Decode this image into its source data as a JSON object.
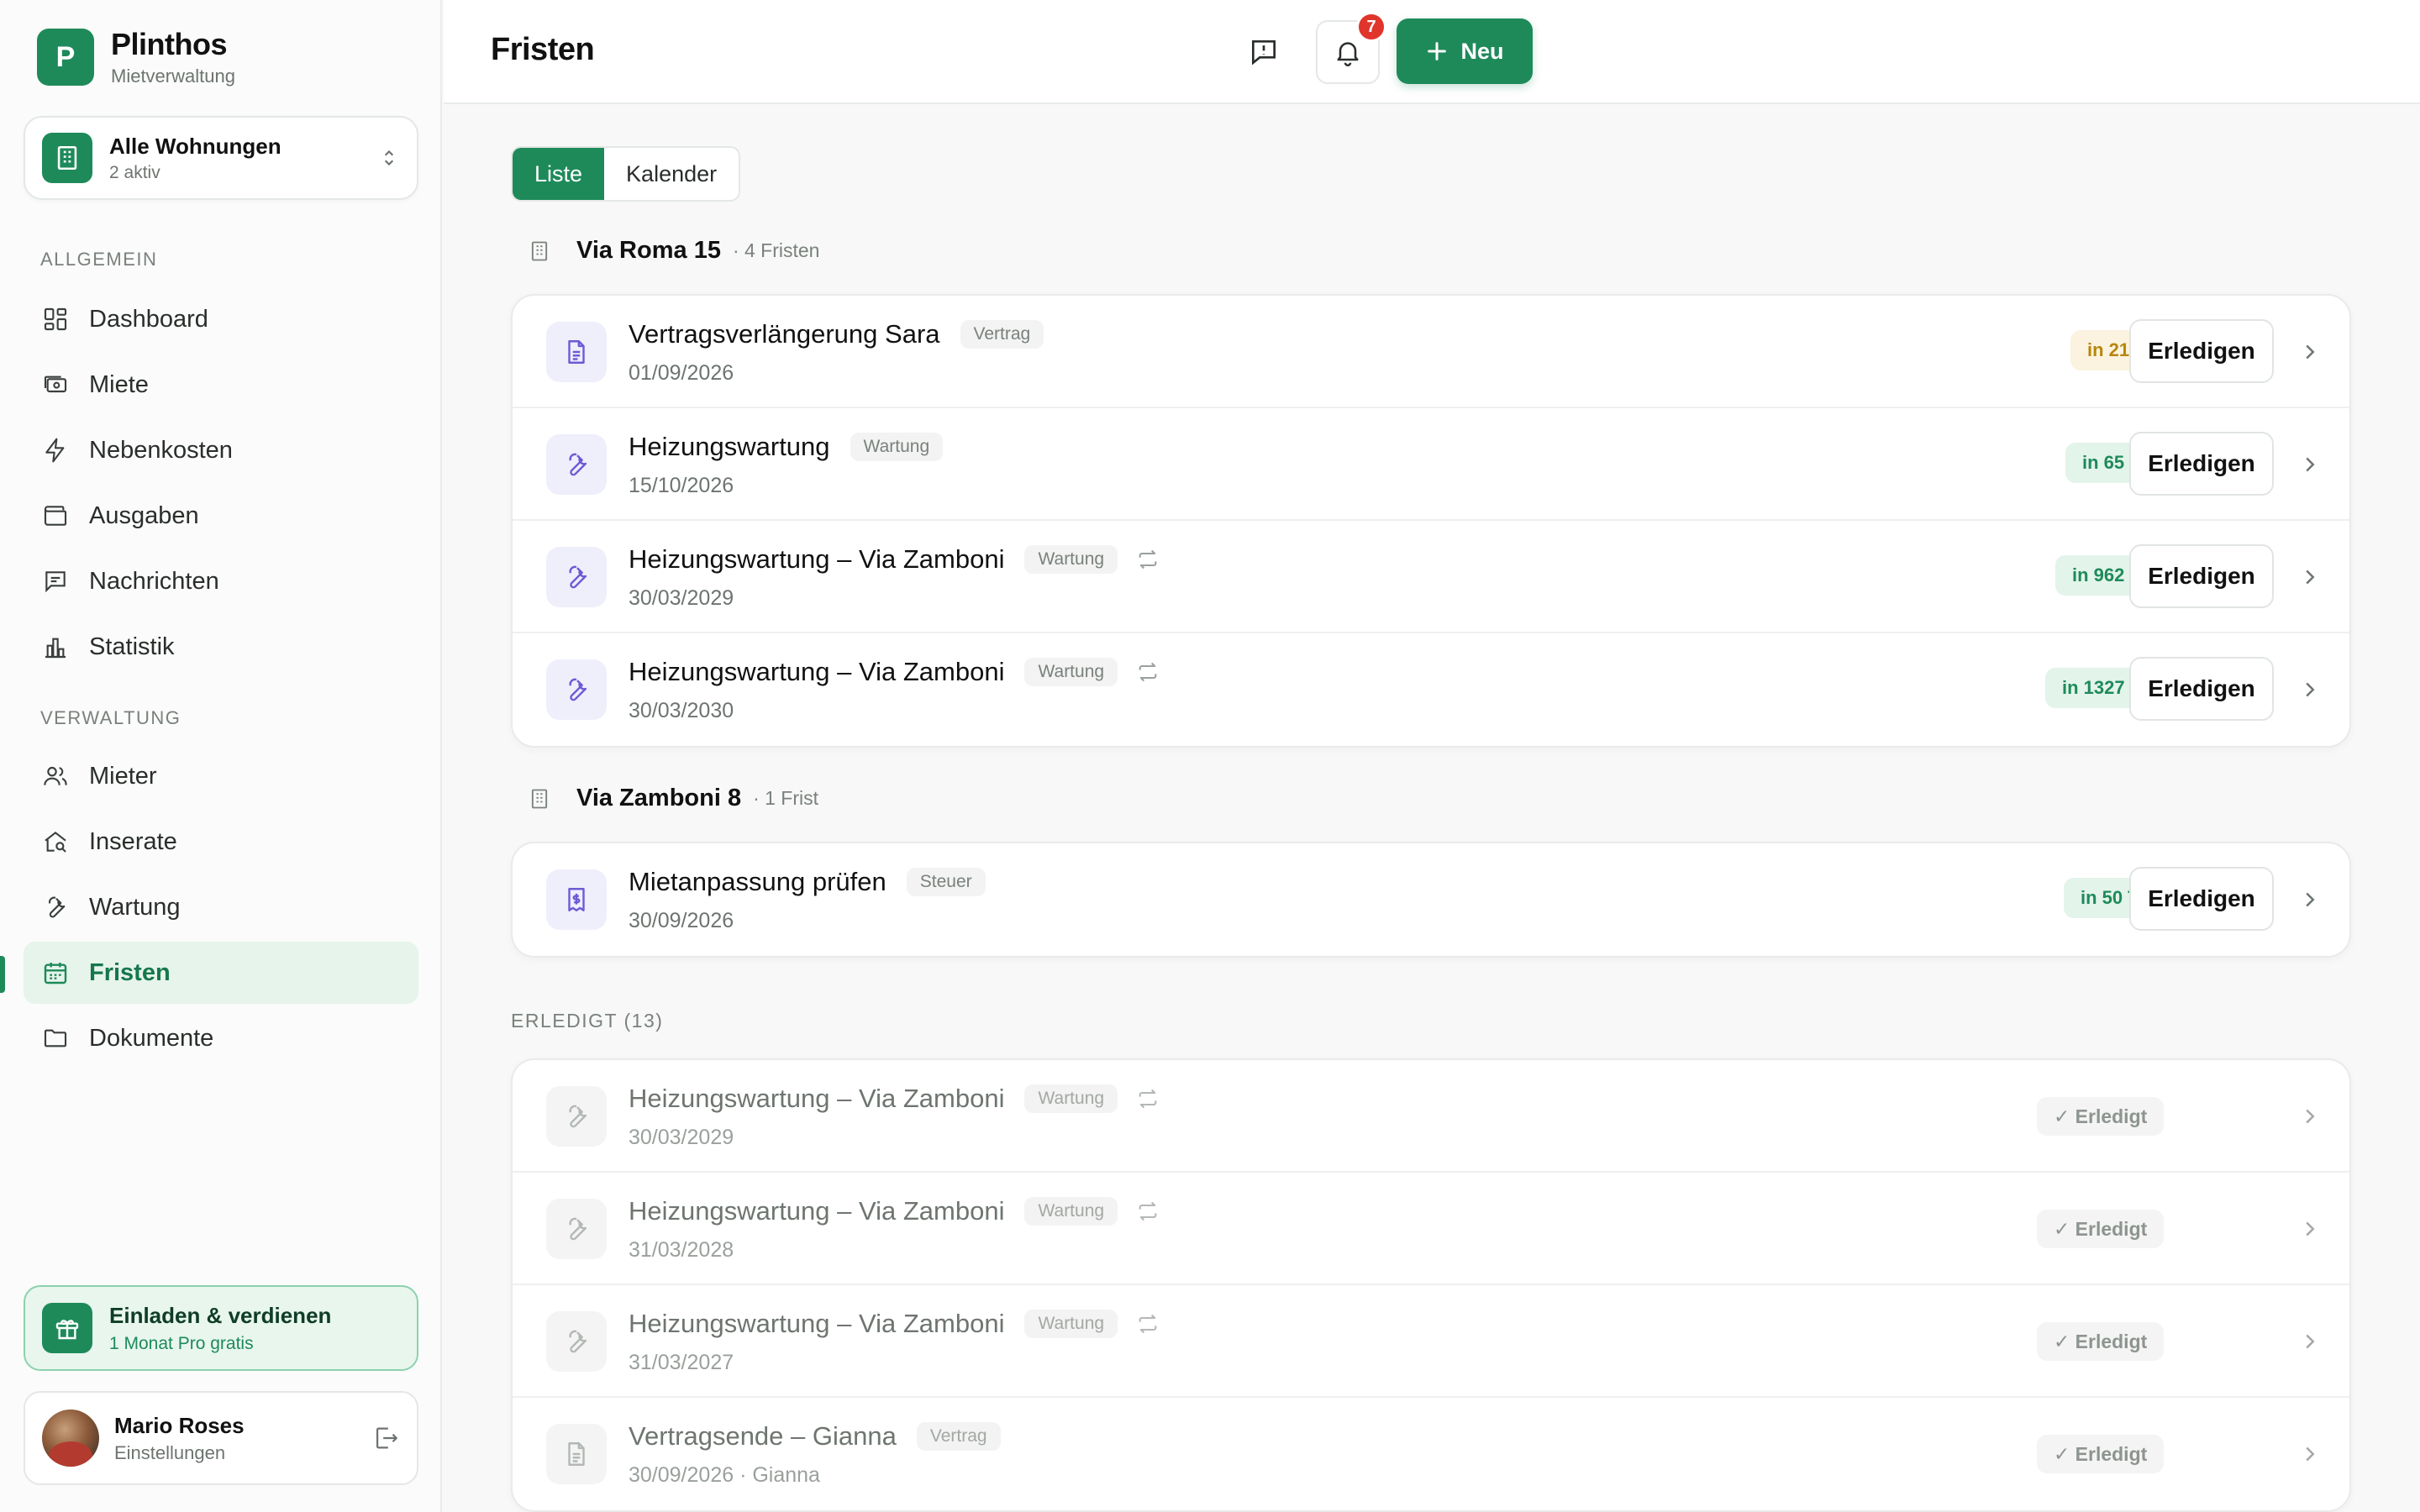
{
  "brand": {
    "name": "Plinthos",
    "subtitle": "Mietverwaltung",
    "logo_letter": "P"
  },
  "switcher": {
    "title": "Alle Wohnungen",
    "subtitle": "2 aktiv"
  },
  "sidebar": {
    "section_general": "ALLGEMEIN",
    "section_admin": "VERWALTUNG",
    "items": [
      {
        "label": "Dashboard",
        "icon": "dashboard-icon"
      },
      {
        "label": "Miete",
        "icon": "cash-icon"
      },
      {
        "label": "Nebenkosten",
        "icon": "lightning-icon"
      },
      {
        "label": "Ausgaben",
        "icon": "wallet-icon"
      },
      {
        "label": "Nachrichten",
        "icon": "message-icon"
      },
      {
        "label": "Statistik",
        "icon": "bar-chart-icon"
      },
      {
        "label": "Mieter",
        "icon": "users-icon"
      },
      {
        "label": "Inserate",
        "icon": "house-search-icon"
      },
      {
        "label": "Wartung",
        "icon": "wrench-icon"
      },
      {
        "label": "Fristen",
        "icon": "calendar-icon",
        "active": true
      },
      {
        "label": "Dokumente",
        "icon": "folder-icon"
      }
    ]
  },
  "invite": {
    "title": "Einladen & verdienen",
    "subtitle": "1 Monat Pro gratis"
  },
  "user": {
    "name": "Mario Roses",
    "subtitle": "Einstellungen"
  },
  "header": {
    "title": "Fristen",
    "notifications": "7",
    "new_label": "Neu"
  },
  "view_toggle": {
    "list": "Liste",
    "calendar": "Kalender",
    "selected": "Liste"
  },
  "groups": [
    {
      "name": "Via Roma 15",
      "count": "· 4 Fristen",
      "rows": [
        {
          "title": "Vertragsverlängerung Sara",
          "tag": "Vertrag",
          "date": "01/09/2026",
          "due": "in 21 T",
          "due_status": "warn",
          "repeat": false,
          "icon": "document-icon",
          "action": "Erledigen"
        },
        {
          "title": "Heizungswartung",
          "tag": "Wartung",
          "date": "15/10/2026",
          "due": "in 65 T",
          "due_status": "ok",
          "repeat": false,
          "icon": "wrench-icon",
          "action": "Erledigen"
        },
        {
          "title": "Heizungswartung – Via Zamboni",
          "tag": "Wartung",
          "date": "30/03/2029",
          "due": "in 962 T",
          "due_status": "ok",
          "repeat": true,
          "icon": "wrench-icon",
          "action": "Erledigen"
        },
        {
          "title": "Heizungswartung – Via Zamboni",
          "tag": "Wartung",
          "date": "30/03/2030",
          "due": "in 1327 T",
          "due_status": "ok",
          "repeat": true,
          "icon": "wrench-icon",
          "action": "Erledigen"
        }
      ]
    },
    {
      "name": "Via Zamboni 8",
      "count": "· 1 Frist",
      "rows": [
        {
          "title": "Mietanpassung prüfen",
          "tag": "Steuer",
          "date": "30/09/2026",
          "due": "in 50 T",
          "due_status": "ok",
          "repeat": false,
          "icon": "receipt-icon",
          "action": "Erledigen"
        }
      ]
    }
  ],
  "completed": {
    "label": "ERLEDIGT (13)",
    "badge": "✓ Erledigt",
    "rows": [
      {
        "title": "Heizungswartung – Via Zamboni",
        "tag": "Wartung",
        "date": "30/03/2029",
        "repeat": true,
        "icon": "wrench-icon"
      },
      {
        "title": "Heizungswartung – Via Zamboni",
        "tag": "Wartung",
        "date": "31/03/2028",
        "repeat": true,
        "icon": "wrench-icon"
      },
      {
        "title": "Heizungswartung – Via Zamboni",
        "tag": "Wartung",
        "date": "31/03/2027",
        "repeat": true,
        "icon": "wrench-icon"
      },
      {
        "title": "Vertragsende – Gianna",
        "tag": "Vertrag",
        "date": "30/09/2026 · Gianna",
        "repeat": false,
        "icon": "document-icon"
      }
    ]
  },
  "colors": {
    "accent": "#1e8a5a",
    "accent_light": "#e6f4ec",
    "warn": "#b7860c",
    "badge_red": "#e0352b",
    "icon_purple": "#6b5bd6"
  }
}
